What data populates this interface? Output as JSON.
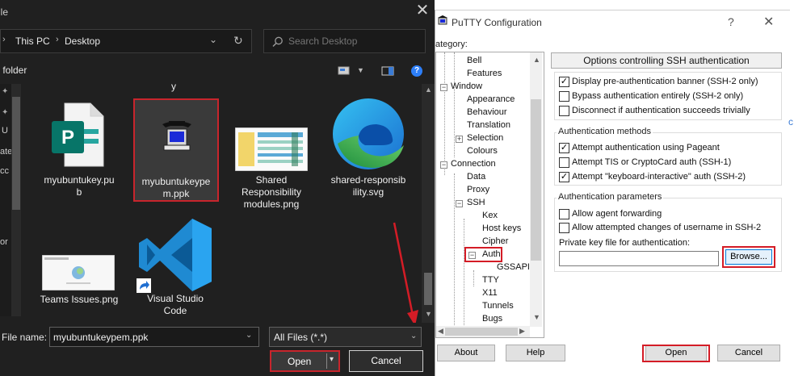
{
  "file_dialog": {
    "title": "ile",
    "breadcrumb": [
      "This PC",
      "Desktop"
    ],
    "search_placeholder": "Search Desktop",
    "toolbar_label": "v folder",
    "partial_top_label": "y",
    "nav_partial_labels": [
      "U",
      "ate",
      "cc",
      "or"
    ],
    "files": [
      {
        "name": "myubuntukey.pu\nb",
        "icon": "publisher-file-icon"
      },
      {
        "name": "myubuntukeype\nm.ppk",
        "icon": "putty-key-icon",
        "selected": true
      },
      {
        "name": "Shared\nResponsibility\nmodules.png",
        "icon": "image-thumbnail-icon"
      },
      {
        "name": "shared-responsib\nility.svg",
        "icon": "edge-icon"
      },
      {
        "name": "Teams Issues.png",
        "icon": "image-thumbnail-icon"
      },
      {
        "name": "Visual Studio\nCode",
        "icon": "vscode-icon",
        "shortcut": true
      }
    ],
    "file_name_label": "File name:",
    "file_name_value": "myubuntukeypem.ppk",
    "file_type_value": "All Files (*.*)",
    "open_label": "Open",
    "cancel_label": "Cancel",
    "close_glyph": "✕",
    "help_glyph": "?"
  },
  "putty": {
    "title": "PuTTY Configuration",
    "help_glyph": "?",
    "close_glyph": "✕",
    "category_label": "ategory:",
    "tree": [
      {
        "label": "Bell",
        "indent": 2
      },
      {
        "label": "Features",
        "indent": 2
      },
      {
        "label": "Window",
        "indent": 1,
        "box": "⊟"
      },
      {
        "label": "Appearance",
        "indent": 2
      },
      {
        "label": "Behaviour",
        "indent": 2
      },
      {
        "label": "Translation",
        "indent": 2
      },
      {
        "label": "Selection",
        "indent": 2,
        "box": "⊞"
      },
      {
        "label": "Colours",
        "indent": 2
      },
      {
        "label": "Connection",
        "indent": 1,
        "box": "⊟"
      },
      {
        "label": "Data",
        "indent": 2
      },
      {
        "label": "Proxy",
        "indent": 2
      },
      {
        "label": "SSH",
        "indent": 2,
        "box": "⊟"
      },
      {
        "label": "Kex",
        "indent": 3
      },
      {
        "label": "Host keys",
        "indent": 3
      },
      {
        "label": "Cipher",
        "indent": 3
      },
      {
        "label": "Auth",
        "indent": 3,
        "box": "⊟",
        "selected": true
      },
      {
        "label": "GSSAPI",
        "indent": 4
      },
      {
        "label": "TTY",
        "indent": 3
      },
      {
        "label": "X11",
        "indent": 3
      },
      {
        "label": "Tunnels",
        "indent": 3
      },
      {
        "label": "Bugs",
        "indent": 3
      }
    ],
    "panel_header": "Options controlling SSH authentication",
    "group1": {
      "items": [
        {
          "label": "Display pre-authentication banner (SSH-2 only)",
          "checked": true
        },
        {
          "label": "Bypass authentication entirely (SSH-2 only)",
          "checked": false
        },
        {
          "label": "Disconnect if authentication succeeds trivially",
          "checked": false
        }
      ]
    },
    "group2": {
      "title": "Authentication methods",
      "items": [
        {
          "label": "Attempt authentication using Pageant",
          "checked": true
        },
        {
          "label": "Attempt TIS or CryptoCard auth (SSH-1)",
          "checked": false
        },
        {
          "label": "Attempt \"keyboard-interactive\" auth (SSH-2)",
          "checked": true
        }
      ]
    },
    "group3": {
      "title": "Authentication parameters",
      "items": [
        {
          "label": "Allow agent forwarding",
          "checked": false
        },
        {
          "label": "Allow attempted changes of username in SSH-2",
          "checked": false
        }
      ],
      "private_key_label": "Private key file for authentication:",
      "private_key_value": "",
      "browse_label": "Browse..."
    },
    "buttons": {
      "about": "About",
      "help": "Help",
      "open": "Open",
      "cancel": "Cancel"
    }
  },
  "right_edge_glyph": "c",
  "colors": {
    "highlight_red": "#d41c26",
    "dark_bg": "#202020",
    "accent_blue": "#0078d7"
  }
}
